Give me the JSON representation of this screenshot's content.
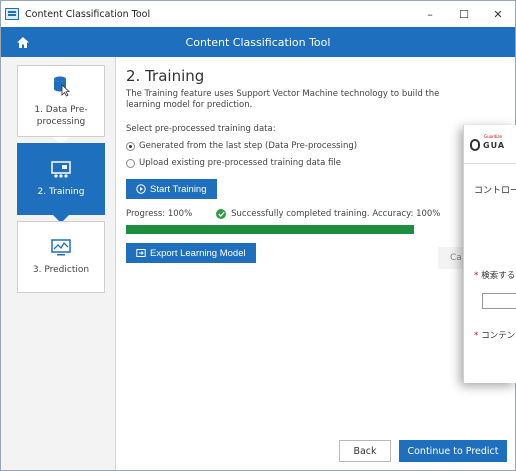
{
  "window": {
    "title": "Content Classification Tool",
    "controls": {
      "minimize": "–",
      "maximize": "☐",
      "close": "✕"
    }
  },
  "appbar": {
    "title": "Content Classification Tool",
    "home_icon": "home-icon"
  },
  "sidebar": {
    "steps": [
      {
        "label": "1. Data Pre-processing",
        "icon": "database-icon",
        "active": false
      },
      {
        "label": "2. Training",
        "icon": "training-board-icon",
        "active": true
      },
      {
        "label": "3. Prediction",
        "icon": "chart-monitor-icon",
        "active": false
      }
    ]
  },
  "main": {
    "title": "2. Training",
    "description": "The Training feature uses Support Vector Machine technology to build the learning model for prediction.",
    "select_label": "Select pre-processed training data:",
    "options": [
      {
        "label": "Generated from the last step (Data Pre-processing)",
        "selected": true
      },
      {
        "label": "Upload existing pre-processed training data file",
        "selected": false
      }
    ],
    "start_button": "Start Training",
    "progress_label": "Progress: 100%",
    "progress_value": 100,
    "status_text": "Successfully completed training. Accuracy: 100%",
    "export_button": "Export Learning Model",
    "cancel_partial": "Ca"
  },
  "footer": {
    "back": "Back",
    "continue": "Continue to Predict"
  },
  "overlay": {
    "brand_text": "GUA",
    "brand_small": "Guardian",
    "heading": "コントロー",
    "field1_label": "検索する",
    "field2_label": "コンテン",
    "required_mark": "*"
  },
  "colors": {
    "accent": "#1f6fbf",
    "success": "#1e8e3e"
  }
}
